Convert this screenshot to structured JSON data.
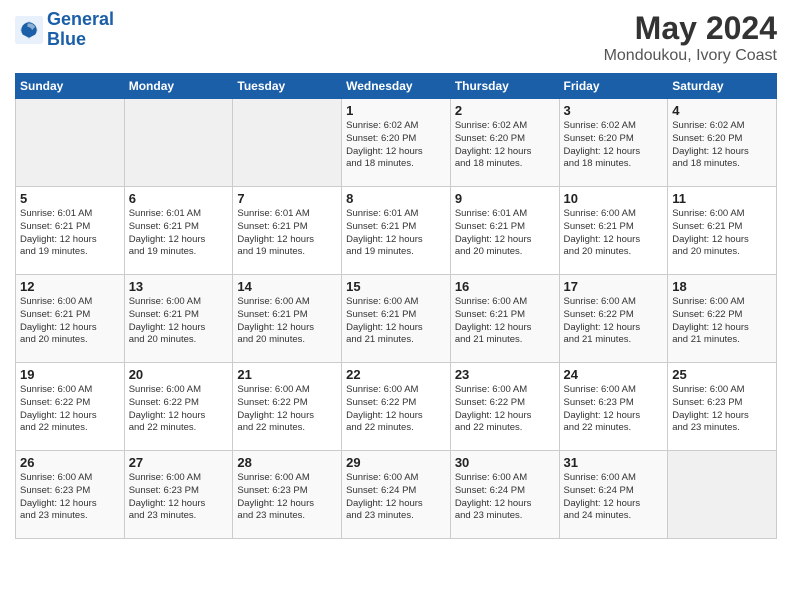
{
  "logo": {
    "line1": "General",
    "line2": "Blue"
  },
  "title": "May 2024",
  "subtitle": "Mondoukou, Ivory Coast",
  "days_of_week": [
    "Sunday",
    "Monday",
    "Tuesday",
    "Wednesday",
    "Thursday",
    "Friday",
    "Saturday"
  ],
  "weeks": [
    [
      {
        "day": "",
        "info": ""
      },
      {
        "day": "",
        "info": ""
      },
      {
        "day": "",
        "info": ""
      },
      {
        "day": "1",
        "info": "Sunrise: 6:02 AM\nSunset: 6:20 PM\nDaylight: 12 hours\nand 18 minutes."
      },
      {
        "day": "2",
        "info": "Sunrise: 6:02 AM\nSunset: 6:20 PM\nDaylight: 12 hours\nand 18 minutes."
      },
      {
        "day": "3",
        "info": "Sunrise: 6:02 AM\nSunset: 6:20 PM\nDaylight: 12 hours\nand 18 minutes."
      },
      {
        "day": "4",
        "info": "Sunrise: 6:02 AM\nSunset: 6:20 PM\nDaylight: 12 hours\nand 18 minutes."
      }
    ],
    [
      {
        "day": "5",
        "info": "Sunrise: 6:01 AM\nSunset: 6:21 PM\nDaylight: 12 hours\nand 19 minutes."
      },
      {
        "day": "6",
        "info": "Sunrise: 6:01 AM\nSunset: 6:21 PM\nDaylight: 12 hours\nand 19 minutes."
      },
      {
        "day": "7",
        "info": "Sunrise: 6:01 AM\nSunset: 6:21 PM\nDaylight: 12 hours\nand 19 minutes."
      },
      {
        "day": "8",
        "info": "Sunrise: 6:01 AM\nSunset: 6:21 PM\nDaylight: 12 hours\nand 19 minutes."
      },
      {
        "day": "9",
        "info": "Sunrise: 6:01 AM\nSunset: 6:21 PM\nDaylight: 12 hours\nand 20 minutes."
      },
      {
        "day": "10",
        "info": "Sunrise: 6:00 AM\nSunset: 6:21 PM\nDaylight: 12 hours\nand 20 minutes."
      },
      {
        "day": "11",
        "info": "Sunrise: 6:00 AM\nSunset: 6:21 PM\nDaylight: 12 hours\nand 20 minutes."
      }
    ],
    [
      {
        "day": "12",
        "info": "Sunrise: 6:00 AM\nSunset: 6:21 PM\nDaylight: 12 hours\nand 20 minutes."
      },
      {
        "day": "13",
        "info": "Sunrise: 6:00 AM\nSunset: 6:21 PM\nDaylight: 12 hours\nand 20 minutes."
      },
      {
        "day": "14",
        "info": "Sunrise: 6:00 AM\nSunset: 6:21 PM\nDaylight: 12 hours\nand 20 minutes."
      },
      {
        "day": "15",
        "info": "Sunrise: 6:00 AM\nSunset: 6:21 PM\nDaylight: 12 hours\nand 21 minutes."
      },
      {
        "day": "16",
        "info": "Sunrise: 6:00 AM\nSunset: 6:21 PM\nDaylight: 12 hours\nand 21 minutes."
      },
      {
        "day": "17",
        "info": "Sunrise: 6:00 AM\nSunset: 6:22 PM\nDaylight: 12 hours\nand 21 minutes."
      },
      {
        "day": "18",
        "info": "Sunrise: 6:00 AM\nSunset: 6:22 PM\nDaylight: 12 hours\nand 21 minutes."
      }
    ],
    [
      {
        "day": "19",
        "info": "Sunrise: 6:00 AM\nSunset: 6:22 PM\nDaylight: 12 hours\nand 22 minutes."
      },
      {
        "day": "20",
        "info": "Sunrise: 6:00 AM\nSunset: 6:22 PM\nDaylight: 12 hours\nand 22 minutes."
      },
      {
        "day": "21",
        "info": "Sunrise: 6:00 AM\nSunset: 6:22 PM\nDaylight: 12 hours\nand 22 minutes."
      },
      {
        "day": "22",
        "info": "Sunrise: 6:00 AM\nSunset: 6:22 PM\nDaylight: 12 hours\nand 22 minutes."
      },
      {
        "day": "23",
        "info": "Sunrise: 6:00 AM\nSunset: 6:22 PM\nDaylight: 12 hours\nand 22 minutes."
      },
      {
        "day": "24",
        "info": "Sunrise: 6:00 AM\nSunset: 6:23 PM\nDaylight: 12 hours\nand 22 minutes."
      },
      {
        "day": "25",
        "info": "Sunrise: 6:00 AM\nSunset: 6:23 PM\nDaylight: 12 hours\nand 23 minutes."
      }
    ],
    [
      {
        "day": "26",
        "info": "Sunrise: 6:00 AM\nSunset: 6:23 PM\nDaylight: 12 hours\nand 23 minutes."
      },
      {
        "day": "27",
        "info": "Sunrise: 6:00 AM\nSunset: 6:23 PM\nDaylight: 12 hours\nand 23 minutes."
      },
      {
        "day": "28",
        "info": "Sunrise: 6:00 AM\nSunset: 6:23 PM\nDaylight: 12 hours\nand 23 minutes."
      },
      {
        "day": "29",
        "info": "Sunrise: 6:00 AM\nSunset: 6:24 PM\nDaylight: 12 hours\nand 23 minutes."
      },
      {
        "day": "30",
        "info": "Sunrise: 6:00 AM\nSunset: 6:24 PM\nDaylight: 12 hours\nand 23 minutes."
      },
      {
        "day": "31",
        "info": "Sunrise: 6:00 AM\nSunset: 6:24 PM\nDaylight: 12 hours\nand 24 minutes."
      },
      {
        "day": "",
        "info": ""
      }
    ]
  ]
}
